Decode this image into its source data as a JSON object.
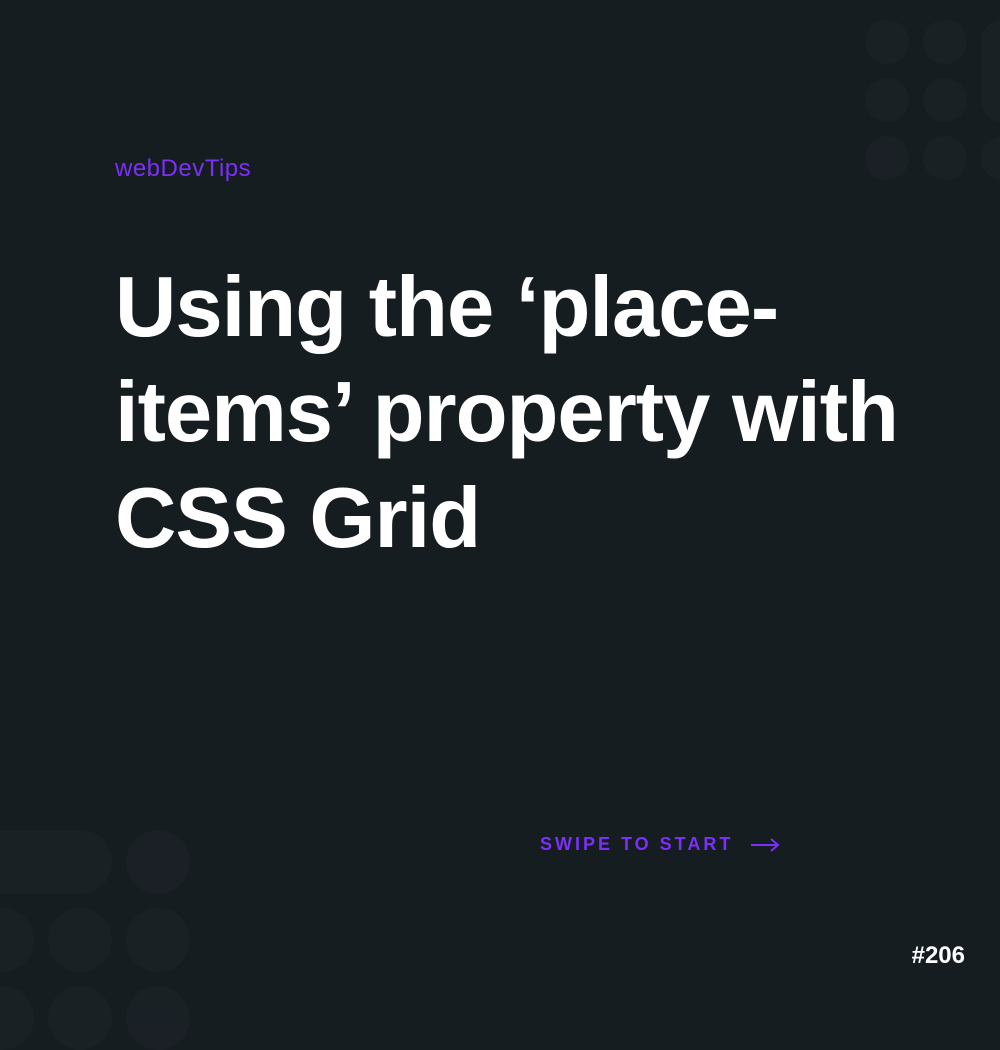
{
  "brand": "webDevTips",
  "title": "Using the ‘place-items’ property with CSS Grid",
  "cta": {
    "label": "SWIPE TO START"
  },
  "issue": "#206",
  "colors": {
    "background": "#161d21",
    "accent": "#7b2ff7",
    "text": "#ffffff"
  }
}
